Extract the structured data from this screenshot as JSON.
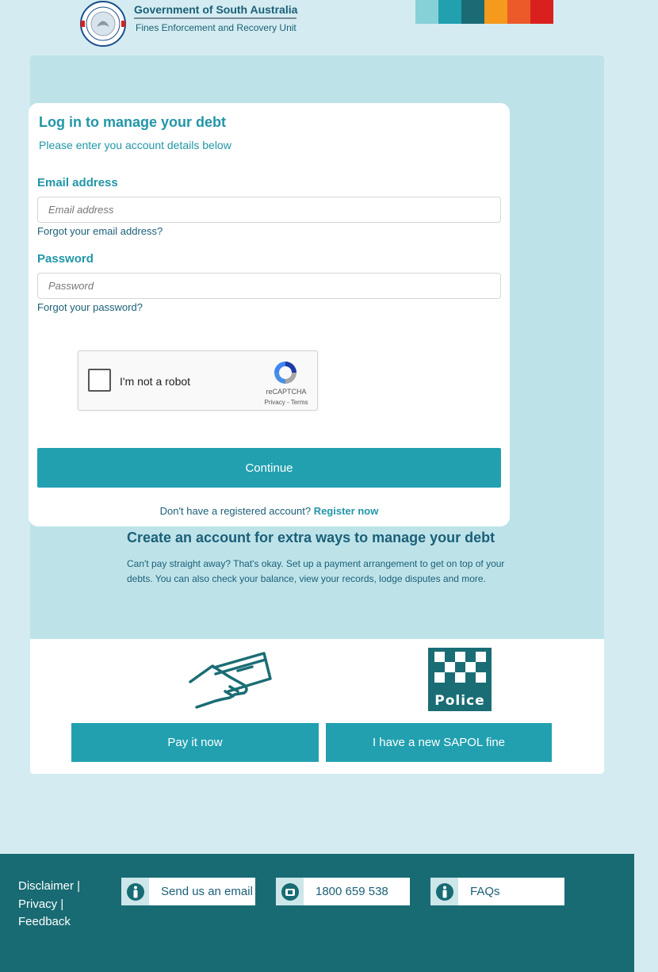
{
  "header": {
    "org_title": "Government of South Australia",
    "org_subtitle": "Fines Enforcement and Recovery Unit",
    "crest_text": "SOUTH AUSTRALIA",
    "stripe_colors": [
      "#86d0d8",
      "#22a0b0",
      "#1a6b74",
      "#f59a1c",
      "#ec5a2a",
      "#d9201f"
    ]
  },
  "login": {
    "title": "Log in to manage your debt",
    "subtitle": "Please enter you account details below",
    "email_label": "Email address",
    "email_placeholder": "Email address",
    "email_value": "",
    "forgot_email": "Forgot your email address?",
    "password_label": "Password",
    "password_placeholder": "Password",
    "password_value": "",
    "forgot_password": "Forgot your password?",
    "captcha_label": "I'm not a robot",
    "captcha_brand": "reCAPTCHA",
    "captcha_links": "Privacy - Terms",
    "continue_label": "Continue",
    "register_prompt": "Don't have a registered account?",
    "register_link": "Register now"
  },
  "create_account": {
    "title": "Create an account for extra ways to manage your debt",
    "text": "Can't pay straight away? That's okay. Set up a payment arrangement to get on top of your debts. You can also check your balance, view your records, lodge disputes and more."
  },
  "actions": {
    "pay_label": "Pay it now",
    "sapol_label": "I have a new SAPOL fine",
    "police_text": "Police"
  },
  "footer": {
    "links": [
      "Disclaimer |",
      "Privacy |",
      "Feedback"
    ],
    "email_label": "Send us an email",
    "phone_label": "1800 659 538",
    "faq_label": "FAQs",
    "icons": [
      "person-icon",
      "phone-icon",
      "person-icon"
    ]
  },
  "colors": {
    "accent": "#22a0b0",
    "dark": "#186b73",
    "panel": "#bde3e9",
    "page": "#d4ecf1"
  }
}
